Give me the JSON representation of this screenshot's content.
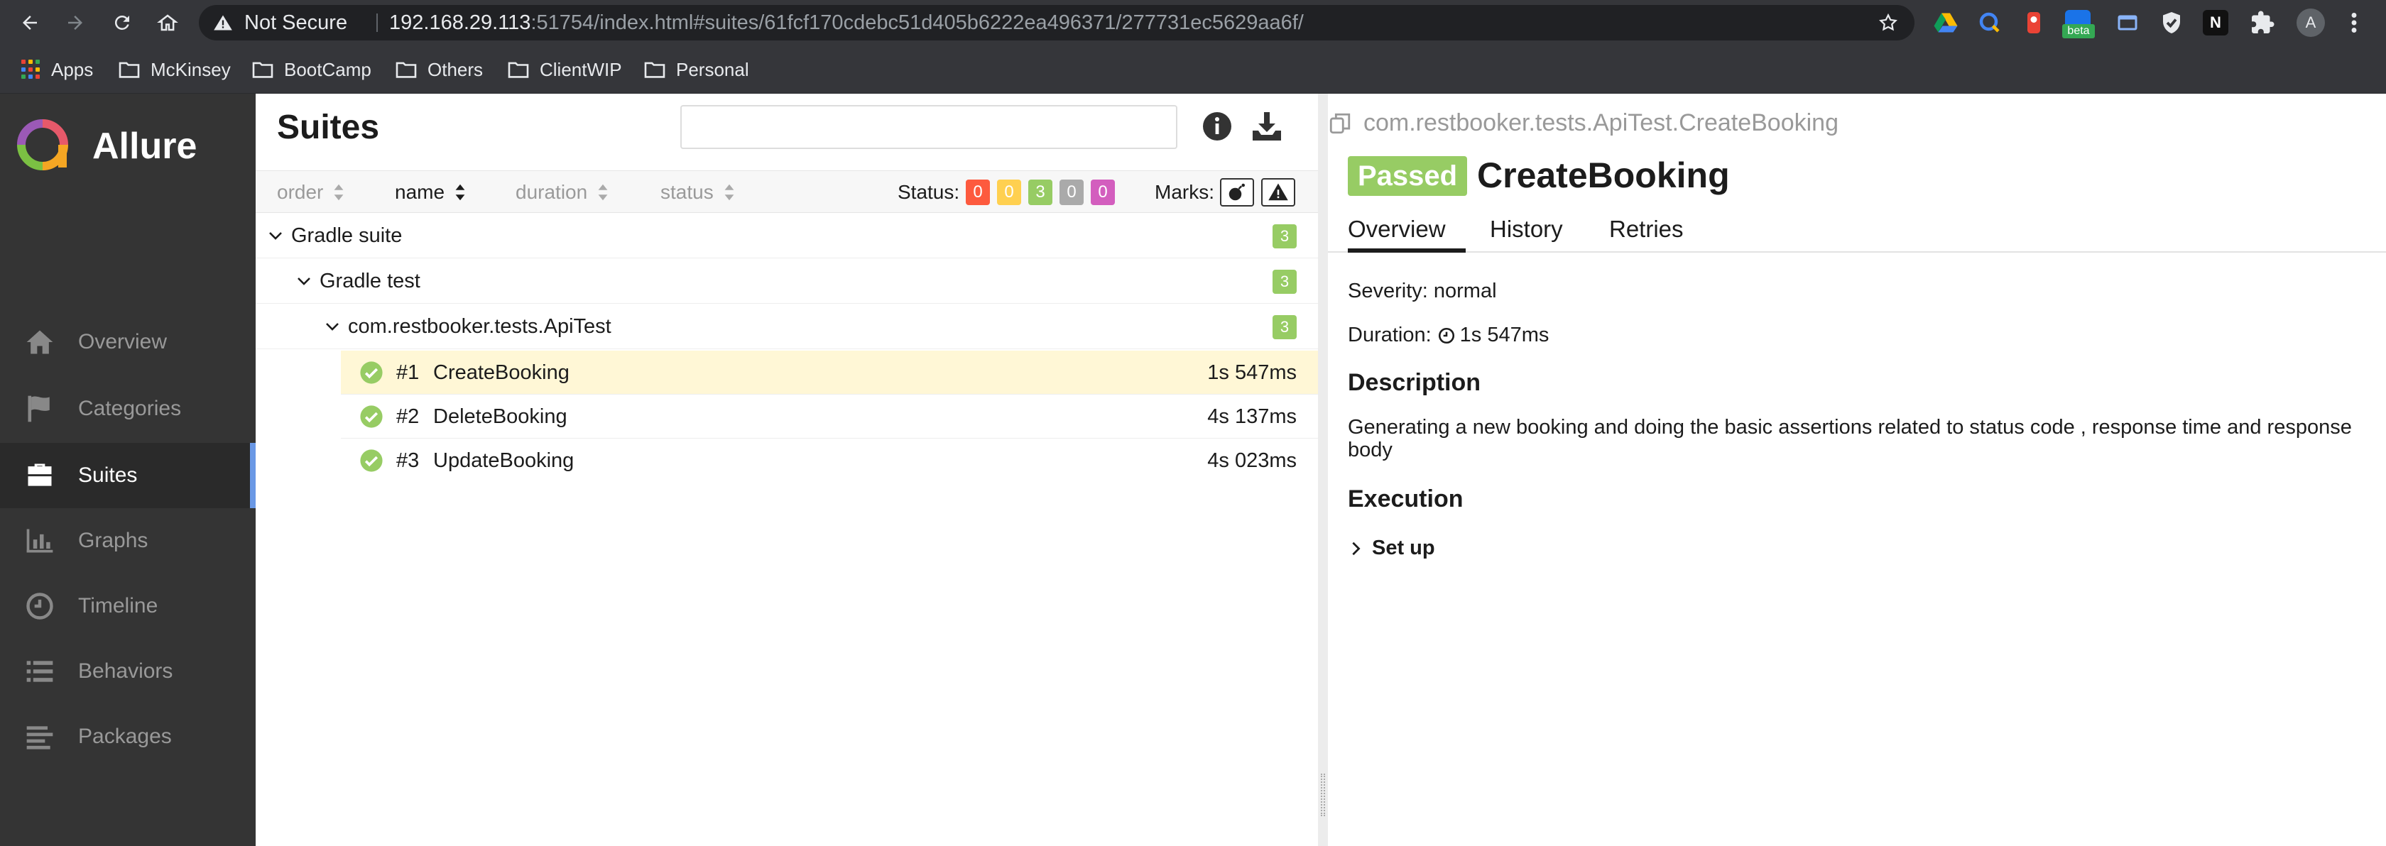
{
  "browser": {
    "not_secure_label": "Not Secure",
    "url_host": "192.168.29.113",
    "url_rest": ":51754/index.html#suites/61fcf170cdebc51d405b6222ea496371/277731ec5629aa6f/",
    "profile_initial": "A",
    "bookmarks": [
      {
        "label": "Apps",
        "icon": "apps-grid-icon"
      },
      {
        "label": "McKinsey",
        "icon": "folder-icon"
      },
      {
        "label": "BootCamp",
        "icon": "folder-icon"
      },
      {
        "label": "Others",
        "icon": "folder-icon"
      },
      {
        "label": "ClientWIP",
        "icon": "folder-icon"
      },
      {
        "label": "Personal",
        "icon": "folder-icon"
      }
    ],
    "extension_badge": "beta"
  },
  "sidebar": {
    "brand": "Allure",
    "items": [
      {
        "label": "Overview",
        "icon": "home-icon"
      },
      {
        "label": "Categories",
        "icon": "flag-icon"
      },
      {
        "label": "Suites",
        "icon": "briefcase-icon",
        "active": true
      },
      {
        "label": "Graphs",
        "icon": "bar-chart-icon"
      },
      {
        "label": "Timeline",
        "icon": "clock-icon"
      },
      {
        "label": "Behaviors",
        "icon": "list-icon"
      },
      {
        "label": "Packages",
        "icon": "align-left-icon"
      }
    ]
  },
  "tree": {
    "title": "Suites",
    "search_placeholder": "",
    "sort": [
      {
        "label": "order"
      },
      {
        "label": "name",
        "active": true
      },
      {
        "label": "duration"
      },
      {
        "label": "status"
      }
    ],
    "status_label": "Status:",
    "status_counts": [
      {
        "value": "0",
        "color": "#fd5a3e"
      },
      {
        "value": "0",
        "color": "#ffd050"
      },
      {
        "value": "3",
        "color": "#97cc64"
      },
      {
        "value": "0",
        "color": "#aaaaaa"
      },
      {
        "value": "0",
        "color": "#d35ebe"
      }
    ],
    "marks_label": "Marks:",
    "groups": [
      {
        "label": "Gradle suite",
        "count": "3"
      },
      {
        "label": "Gradle test",
        "count": "3"
      },
      {
        "label": "com.restbooker.tests.ApiTest",
        "count": "3"
      }
    ],
    "tests": [
      {
        "num": "#1",
        "name": "CreateBooking",
        "duration": "1s 547ms",
        "selected": true
      },
      {
        "num": "#2",
        "name": "DeleteBooking",
        "duration": "4s 137ms"
      },
      {
        "num": "#3",
        "name": "UpdateBooking",
        "duration": "4s 023ms"
      }
    ]
  },
  "detail": {
    "full_name": "com.restbooker.tests.ApiTest.CreateBooking",
    "status": "Passed",
    "status_color": "#97cc64",
    "title": "CreateBooking",
    "tabs": [
      {
        "label": "Overview",
        "active": true
      },
      {
        "label": "History"
      },
      {
        "label": "Retries"
      }
    ],
    "severity": "Severity: normal",
    "duration_label": "Duration:",
    "duration_value": "1s 547ms",
    "description_heading": "Description",
    "description": "Generating a new booking and doing the basic assertions related to status code , response time and response body",
    "execution_heading": "Execution",
    "setup_label": "Set up"
  }
}
